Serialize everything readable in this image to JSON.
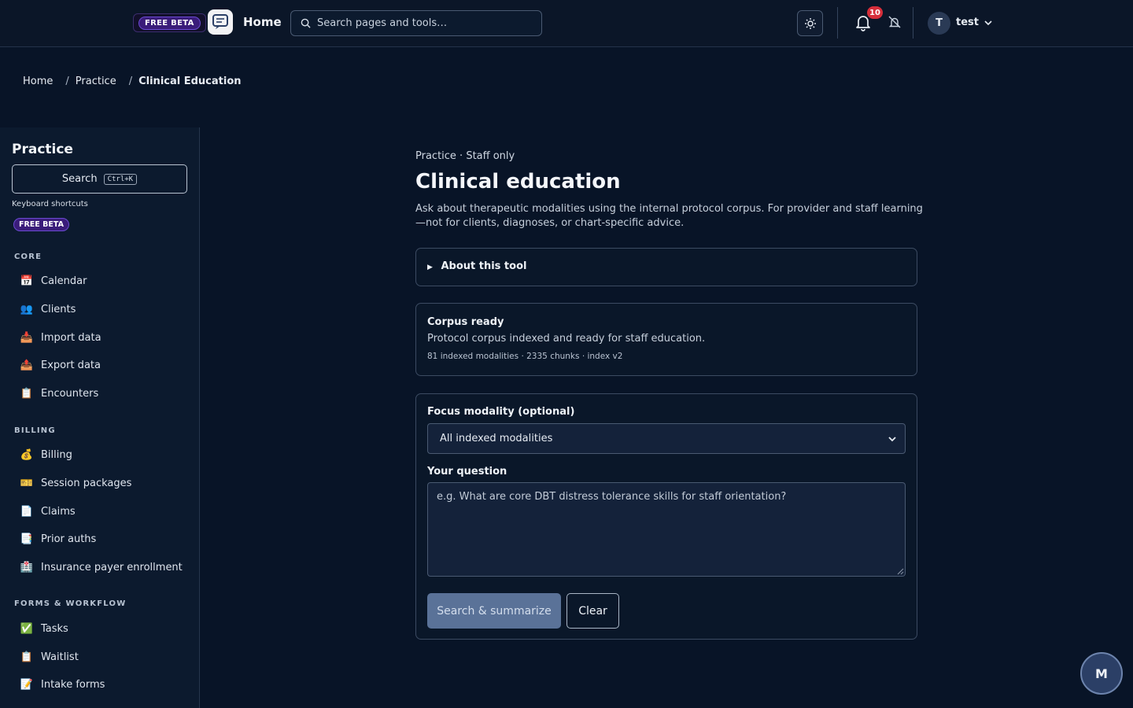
{
  "header": {
    "beta_label": "FREE BETA",
    "home_label": "Home",
    "search_placeholder": "Search pages and tools…",
    "notification_count": "10",
    "avatar_initial": "T",
    "user_name": "test"
  },
  "breadcrumb": {
    "items": [
      "Home",
      "Practice",
      "Clinical Education"
    ]
  },
  "sidebar": {
    "title": "Practice",
    "search_label": "Search",
    "search_shortcut": "Ctrl+K",
    "shortcuts_label": "Keyboard shortcuts",
    "beta_label": "FREE BETA",
    "sections": [
      {
        "label": "CORE",
        "items": [
          {
            "icon": "📅",
            "label": "Calendar"
          },
          {
            "icon": "👥",
            "label": "Clients"
          },
          {
            "icon": "📥",
            "label": "Import data"
          },
          {
            "icon": "📤",
            "label": "Export data"
          },
          {
            "icon": "📋",
            "label": "Encounters"
          }
        ]
      },
      {
        "label": "BILLING",
        "items": [
          {
            "icon": "💰",
            "label": "Billing"
          },
          {
            "icon": "🎫",
            "label": "Session packages"
          },
          {
            "icon": "📄",
            "label": "Claims"
          },
          {
            "icon": "📑",
            "label": "Prior auths"
          },
          {
            "icon": "🏥",
            "label": "Insurance payer enrollment"
          }
        ]
      },
      {
        "label": "FORMS & WORKFLOW",
        "items": [
          {
            "icon": "✅",
            "label": "Tasks"
          },
          {
            "icon": "📋",
            "label": "Waitlist"
          },
          {
            "icon": "📝",
            "label": "Intake forms"
          }
        ]
      }
    ]
  },
  "main": {
    "eyebrow": "Practice · Staff only",
    "title": "Clinical education",
    "description": "Ask about therapeutic modalities using the internal protocol corpus. For provider and staff learning—not for clients, diagnoses, or chart-specific advice.",
    "about_label": "About this tool",
    "corpus": {
      "heading": "Corpus ready",
      "body": "Protocol corpus indexed and ready for staff education.",
      "meta": "81 indexed modalities · 2335 chunks · index v2"
    },
    "form": {
      "modality_label": "Focus modality (optional)",
      "modality_value": "All indexed modalities",
      "question_label": "Your question",
      "question_placeholder": "e.g. What are core DBT distress tolerance skills for staff orientation?",
      "submit_label": "Search & summarize",
      "clear_label": "Clear"
    }
  },
  "fab": {
    "initial": "M"
  },
  "colors": {
    "background": "#081427",
    "panel": "#0c1a2e",
    "accent_button": "#5a7298",
    "beta_purple": "#3a1c7a",
    "badge_red": "#d62e3a"
  }
}
